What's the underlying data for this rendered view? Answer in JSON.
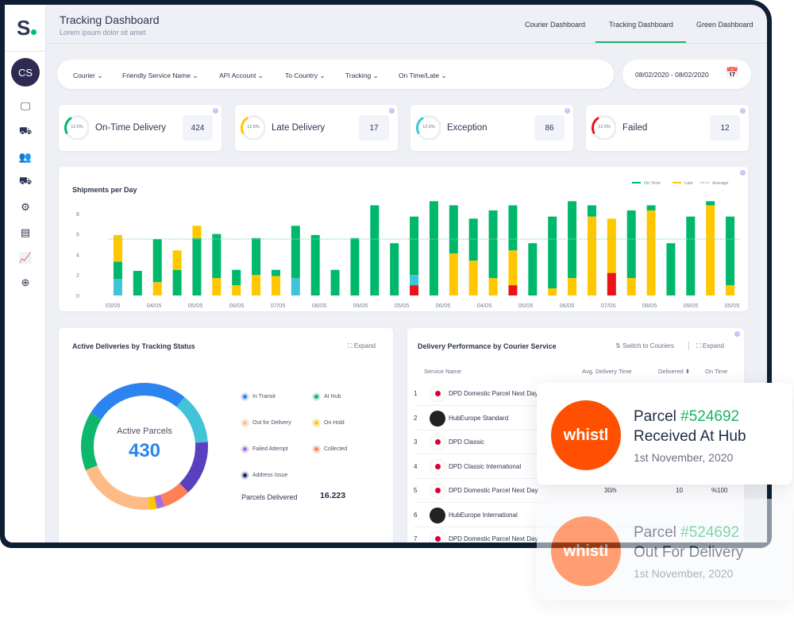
{
  "header": {
    "title": "Tracking Dashboard",
    "subtitle": "Lorem ipsum dolor sit amet"
  },
  "tabs": [
    {
      "label": "Courier Dashboard"
    },
    {
      "label": "Tracking Dashboard",
      "active": true
    },
    {
      "label": "Green Dashboard"
    }
  ],
  "sidebar": {
    "logo": "S",
    "avatar": "CS",
    "icons": [
      "monitor-icon",
      "truck-icon",
      "users-icon",
      "fast-truck-icon",
      "users-settings-icon",
      "book-icon",
      "chart-icon",
      "globe-icon"
    ]
  },
  "filters": [
    "Courier",
    "Friendly Service Name",
    "API Account",
    "To Country",
    "Tracking",
    "On Time/Late"
  ],
  "date_range": "08/02/2020 - 08/02/2020",
  "kpis": [
    {
      "percent": "12.6%",
      "label": "On-Time Delivery",
      "value": "424",
      "color": "#00b86b"
    },
    {
      "percent": "12.6%",
      "label": "Late Delivery",
      "value": "17",
      "color": "#ffc700"
    },
    {
      "percent": "12.6%",
      "label": "Exception",
      "value": "86",
      "color": "#40c4d8"
    },
    {
      "percent": "12.6%",
      "label": "Failed",
      "value": "12",
      "color": "#e8141a"
    }
  ],
  "chart_data": {
    "type": "bar",
    "stacked": true,
    "title": "Shipments per Day",
    "legend": {
      "position": "top-right",
      "entries": [
        {
          "name": "On Time",
          "color": "#00b86b"
        },
        {
          "name": "Late",
          "color": "#ffc700"
        },
        {
          "name": "Average",
          "color": "#7fd8a8",
          "style": "dotted"
        }
      ]
    },
    "yticks": [
      0,
      2,
      4,
      6,
      8
    ],
    "ylim": [
      0,
      9.5
    ],
    "average": 5.5,
    "grid": false,
    "colors": {
      "ontime": "#00b86b",
      "late": "#ffc700",
      "exception": "#40c4d8",
      "failed": "#e8141a"
    },
    "xlabels": [
      "03/05",
      "04/05",
      "05/05",
      "06/05",
      "07/05",
      "08/05",
      "09/05",
      "05/05",
      "06/05",
      "04/05",
      "05/05",
      "06/05",
      "07/05",
      "08/05",
      "09/05",
      "05/05"
    ],
    "bars": [
      [
        [
          "exception",
          1.6
        ],
        [
          "ontime",
          1.7
        ],
        [
          "late",
          2.6
        ]
      ],
      [
        [
          "ontime",
          2.4
        ]
      ],
      [
        [
          "late",
          1.3
        ],
        [
          "ontime",
          4.2
        ]
      ],
      [
        [
          "ontime",
          2.5
        ],
        [
          "late",
          1.9
        ]
      ],
      [
        [
          "ontime",
          5.6
        ],
        [
          "late",
          1.2
        ]
      ],
      [
        [
          "late",
          1.7
        ],
        [
          "ontime",
          4.3
        ]
      ],
      [
        [
          "late",
          1.0
        ],
        [
          "ontime",
          1.5
        ]
      ],
      [
        [
          "late",
          2.0
        ],
        [
          "ontime",
          3.6
        ]
      ],
      [
        [
          "late",
          1.9
        ],
        [
          "ontime",
          0.6
        ]
      ],
      [
        [
          "exception",
          1.7
        ],
        [
          "ontime",
          5.1
        ]
      ],
      [
        [
          "ontime",
          5.9
        ]
      ],
      [
        [
          "ontime",
          2.5
        ]
      ],
      [
        [
          "ontime",
          5.6
        ]
      ],
      [
        [
          "ontime",
          8.8
        ]
      ],
      [
        [
          "ontime",
          5.1
        ]
      ],
      [
        [
          "failed",
          1.0
        ],
        [
          "exception",
          1.0
        ],
        [
          "ontime",
          5.7
        ]
      ],
      [
        [
          "ontime",
          9.2
        ]
      ],
      [
        [
          "late",
          4.1
        ],
        [
          "ontime",
          4.7
        ]
      ],
      [
        [
          "late",
          3.4
        ],
        [
          "ontime",
          4.1
        ]
      ],
      [
        [
          "late",
          1.7
        ],
        [
          "ontime",
          6.6
        ]
      ],
      [
        [
          "failed",
          1.0
        ],
        [
          "late",
          3.4
        ],
        [
          "ontime",
          4.4
        ]
      ],
      [
        [
          "ontime",
          5.1
        ]
      ],
      [
        [
          "late",
          0.7
        ],
        [
          "ontime",
          7.0
        ]
      ],
      [
        [
          "late",
          1.7
        ],
        [
          "ontime",
          7.5
        ]
      ],
      [
        [
          "late",
          7.7
        ],
        [
          "ontime",
          1.1
        ]
      ],
      [
        [
          "failed",
          2.2
        ],
        [
          "late",
          5.3
        ]
      ],
      [
        [
          "late",
          1.7
        ],
        [
          "ontime",
          6.6
        ]
      ],
      [
        [
          "late",
          8.3
        ],
        [
          "ontime",
          0.5
        ]
      ],
      [
        [
          "ontime",
          5.1
        ]
      ],
      [
        [
          "ontime",
          7.7
        ]
      ],
      [
        [
          "late",
          8.8
        ],
        [
          "ontime",
          0.4
        ]
      ],
      [
        [
          "late",
          1.0
        ],
        [
          "ontime",
          6.7
        ]
      ]
    ]
  },
  "active": {
    "title": "Active Deliveries by Tracking Status",
    "expand": "Expand",
    "center_label": "Active Parcels",
    "center_value": "430",
    "segments": [
      {
        "name": "In Transit",
        "color": "#2b84f0",
        "value": 27
      },
      {
        "name": "Exception",
        "color": "#42c3d8",
        "value": 13
      },
      {
        "name": "Address Issue",
        "color": "#5a40bf",
        "value": 14
      },
      {
        "name": "Collected",
        "color": "#ff7f57",
        "value": 7
      },
      {
        "name": "Failed Attempt",
        "color": "#a56ee0",
        "value": 2
      },
      {
        "name": "On Hold",
        "color": "#ffc700",
        "value": 2
      },
      {
        "name": "Out for Delivery",
        "color": "#ffbb85",
        "value": 20
      },
      {
        "name": "At Hub",
        "color": "#0db86c",
        "value": 15
      }
    ],
    "legend": [
      {
        "name": "In Transit",
        "color": "#2b84f0"
      },
      {
        "name": "At Hub",
        "color": "#0db86c"
      },
      {
        "name": "Out for Delivery",
        "color": "#ffbb85"
      },
      {
        "name": "On Hold",
        "color": "#ffc700"
      },
      {
        "name": "Failed Attempt",
        "color": "#a56ee0"
      },
      {
        "name": "Collected",
        "color": "#ff7f57"
      },
      {
        "name": "Address Issue",
        "color": "#1c2a6b"
      }
    ],
    "delivered_label": "Parcels Delivered",
    "delivered_value": "16.223"
  },
  "performance": {
    "title": "Delivery Performance by Courier Service",
    "switch": "Switch to Couriers",
    "expand": "Expand",
    "columns": [
      "Service Name",
      "Avg. Delivery Time",
      "Delivered",
      "On Time"
    ],
    "rows": [
      {
        "n": "1",
        "name": "DPD Domestic Parcel Next Day",
        "logo": "dpd"
      },
      {
        "n": "2",
        "name": "HubEurope Standard",
        "logo": "hub"
      },
      {
        "n": "3",
        "name": "DPD Classic",
        "logo": "dpd"
      },
      {
        "n": "4",
        "name": "DPD Classic International",
        "logo": "dpd"
      },
      {
        "n": "5",
        "name": "DPD Domestic Parcel Next Day",
        "logo": "dpd",
        "avg": "30/h",
        "delivered": "10",
        "ontime": "%100"
      },
      {
        "n": "6",
        "name": "HubEurope International",
        "logo": "hub"
      },
      {
        "n": "7",
        "name": "DPD Domestic Parcel Next Day",
        "logo": "dpd"
      }
    ]
  },
  "notifications": [
    {
      "brand": "whistl",
      "prefix": "Parcel ",
      "id": "#524692",
      "status": "Received At Hub",
      "date": "1st November, 2020"
    },
    {
      "brand": "whistl",
      "prefix": "Parcel ",
      "id": "#524692",
      "status": "Out For Delivery",
      "date": "1st November, 2020"
    }
  ]
}
